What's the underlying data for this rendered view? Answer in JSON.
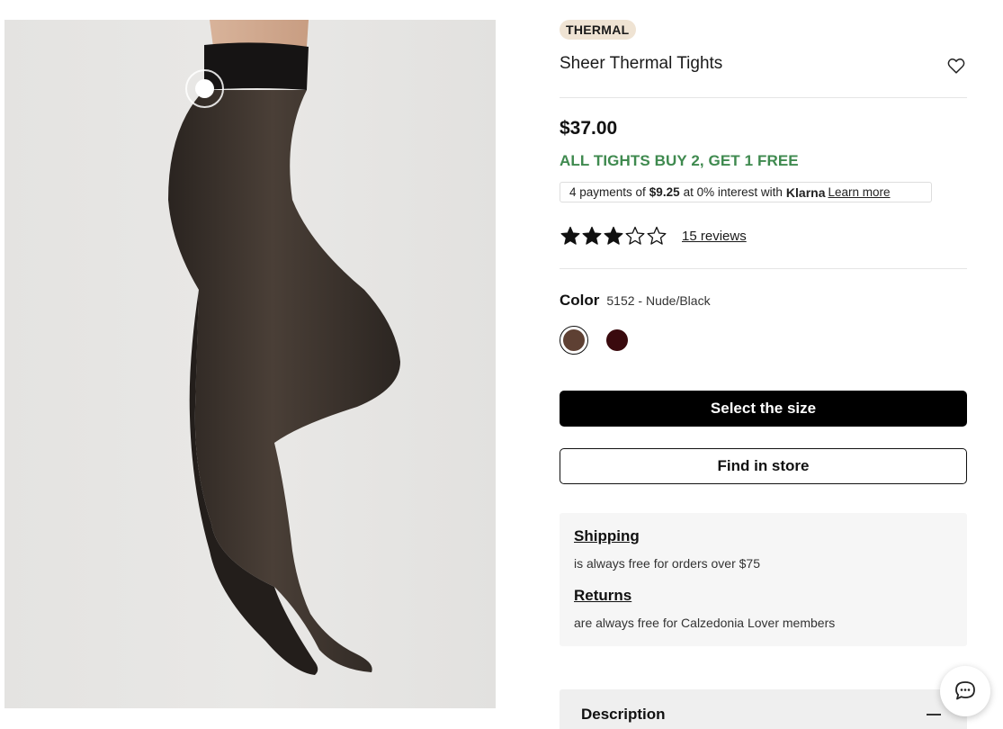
{
  "product": {
    "badge": "THERMAL",
    "title": "Sheer Thermal Tights",
    "price": "$37.00",
    "promo": "ALL TIGHTS BUY 2, GET 1 FREE"
  },
  "klarna": {
    "prefix": "4 payments of",
    "amount": "$9.25",
    "middle": "at 0% interest with",
    "brand": "Klarna",
    "link": "Learn more"
  },
  "rating": {
    "stars": 3,
    "max": 5,
    "reviews_label": "15 reviews"
  },
  "color": {
    "label": "Color",
    "value": "5152 - Nude/Black",
    "swatches": [
      {
        "name": "Nude/Black",
        "hex": "#5e4033",
        "selected": true
      },
      {
        "name": "Burgundy",
        "hex": "#3a0a0e",
        "selected": false
      }
    ]
  },
  "buttons": {
    "select_size": "Select the size",
    "find_store": "Find in store"
  },
  "info": {
    "shipping_title": "Shipping",
    "shipping_text": "is always free for orders over $75",
    "returns_title": "Returns",
    "returns_text": "are always free for Calzedonia Lover members"
  },
  "description": {
    "label": "Description"
  },
  "icons": {
    "wishlist": "heart-icon",
    "chat": "chat-bubble-icon",
    "collapse": "minus-icon"
  },
  "colors": {
    "promo_green": "#3f8a4f",
    "badge_bg": "#efe3d3",
    "primary_button": "#000000"
  }
}
